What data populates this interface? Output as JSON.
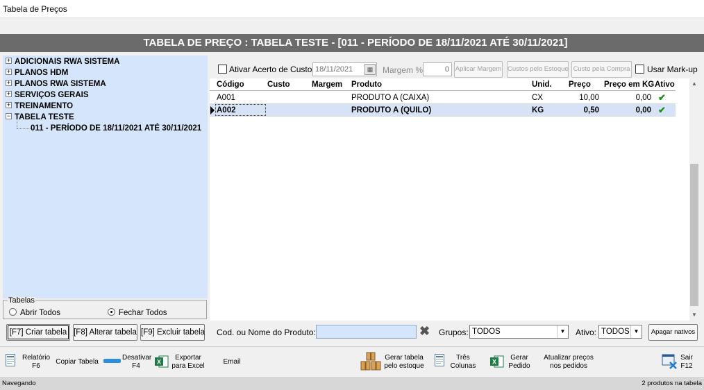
{
  "window": {
    "title": "Tabela de Preços"
  },
  "header": {
    "title": "TABELA DE PREÇO : TABELA TESTE  -  [011 - PERÍODO DE 18/11/2021 ATÉ 30/11/2021]"
  },
  "tree": {
    "items": [
      {
        "label": "ADICIONAIS RWA SISTEMA",
        "expander": "+"
      },
      {
        "label": "PLANOS HDM",
        "expander": "+"
      },
      {
        "label": "PLANOS RWA SISTEMA",
        "expander": "+"
      },
      {
        "label": "SERVIÇOS GERAIS",
        "expander": "+"
      },
      {
        "label": "TREINAMENTO",
        "expander": "+"
      },
      {
        "label": "TABELA TESTE",
        "expander": "−"
      }
    ],
    "child": {
      "label": "011 - PERÍODO DE 18/11/2021 ATÉ 30/11/2021"
    }
  },
  "tabelas": {
    "legend": "Tabelas",
    "open_all": "Abrir Todos",
    "close_all": "Fechar Todos",
    "selected": "close_all"
  },
  "left_buttons": {
    "create": "[F7] Criar tabela",
    "edit": "[F8] Alterar tabela",
    "delete": "[F9] Excluir tabela"
  },
  "options": {
    "ativar_acerto": "Ativar Acerto de Custo",
    "ativar_acerto_checked": false,
    "date": "18/11/2021",
    "margem_label": "Margem %",
    "margem_value": "0",
    "aplicar_margem": "Aplicar Margem",
    "custos_estoque": "Custos pelo Estoque",
    "custo_compra": "Custo pela Compra",
    "usar_markup": "Usar Mark-up",
    "usar_markup_checked": false
  },
  "grid": {
    "columns": [
      "Código",
      "Custo",
      "Margem",
      "Produto",
      "Unid.",
      "Preço",
      "Preço em KG",
      "Ativo"
    ],
    "rows": [
      {
        "codigo": "A001",
        "custo": "",
        "margem": "",
        "produto": "PRODUTO A (CAIXA)",
        "unid": "CX",
        "preco": "10,00",
        "preco_kg": "0,00",
        "ativo": "✔"
      },
      {
        "codigo": "A002",
        "custo": "",
        "margem": "",
        "produto": "PRODUTO A (QUILO)",
        "unid": "KG",
        "preco": "0,50",
        "preco_kg": "0,00",
        "ativo": "✔"
      }
    ],
    "selected_row": 1
  },
  "filters": {
    "product_label": "Cod. ou Nome do Produto:",
    "product_value": "",
    "grupos_label": "Grupos:",
    "grupos_value": "TODOS",
    "ativo_label": "Ativo:",
    "ativo_value": "TODOS",
    "apagar_nativos": "Apagar nativos"
  },
  "toolbar": {
    "relatorio": "Relatório",
    "relatorio_key": "F6",
    "copiar": "Copiar Tabela",
    "desativar": "Desativar",
    "desativar_key": "F4",
    "exportar": "Exportar",
    "exportar_2": "para Excel",
    "email": "Email",
    "gerar_tabela": "Gerar tabela",
    "gerar_tabela_2": "pelo estoque",
    "tres": "Três",
    "tres_2": "Colunas",
    "gerar_pedido": "Gerar",
    "gerar_pedido_2": "Pedido",
    "atualizar": "Atualizar preços",
    "atualizar_2": "nos pedidos",
    "sair": "Sair",
    "sair_key": "F12"
  },
  "status": {
    "left": "Navegando",
    "right": "2 produtos na tabela"
  },
  "colors": {
    "header_bg": "#6b6b6b",
    "tree_bg": "#d5e5fb",
    "selected_row": "#d6e3f7",
    "check_green": "#1a8f1a"
  }
}
